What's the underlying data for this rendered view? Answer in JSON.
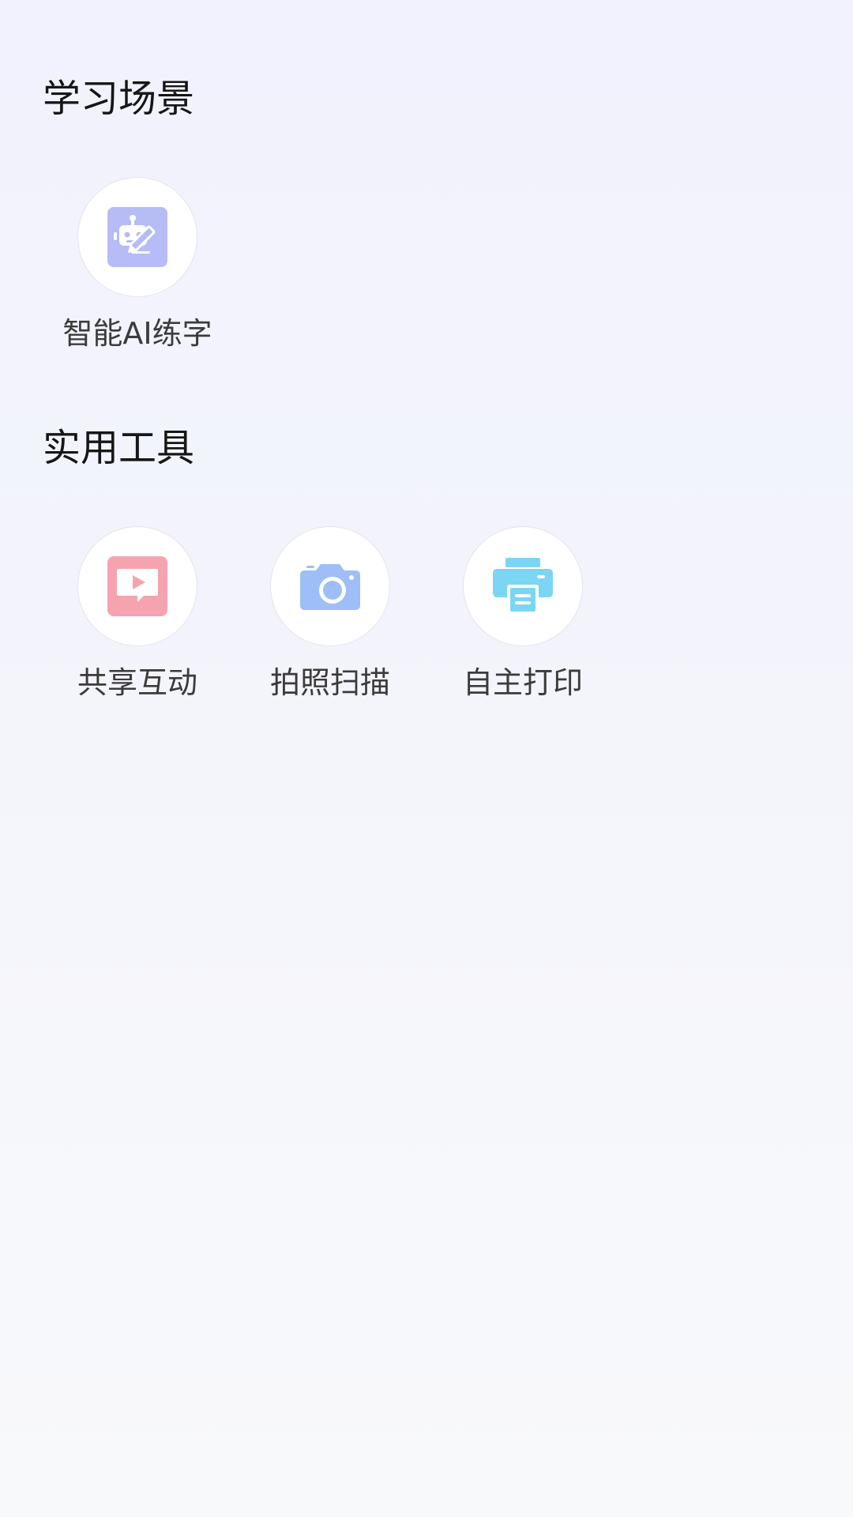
{
  "sections": {
    "learning": {
      "title": "学习场景",
      "items": [
        {
          "label": "智能AI练字",
          "icon": "robot-pen-icon",
          "color": "#b6bcf6"
        }
      ]
    },
    "tools": {
      "title": "实用工具",
      "items": [
        {
          "label": "共享互动",
          "icon": "share-play-icon",
          "color": "#f6a3b0"
        },
        {
          "label": "拍照扫描",
          "icon": "camera-icon",
          "color": "#9ebef8"
        },
        {
          "label": "自主打印",
          "icon": "printer-icon",
          "color": "#7cd5f3"
        }
      ]
    }
  }
}
